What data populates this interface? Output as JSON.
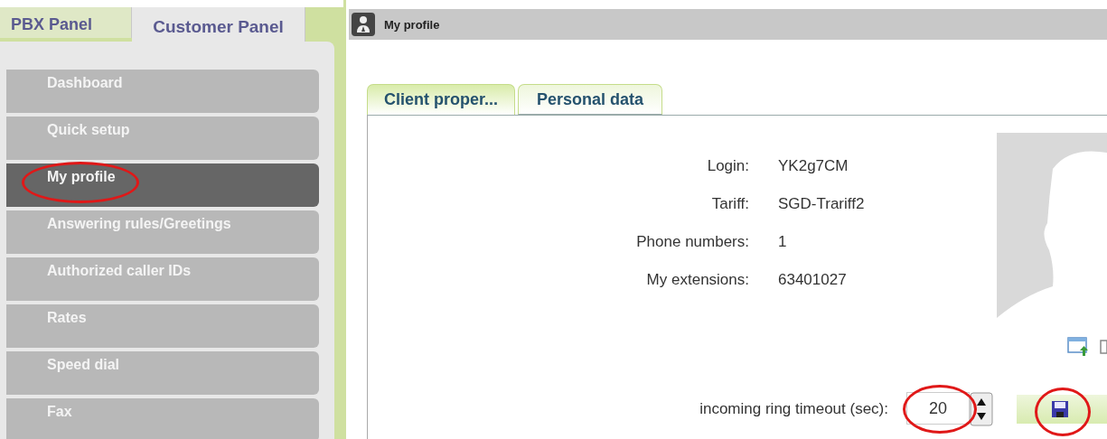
{
  "panel_tabs": [
    {
      "label": "PBX Panel",
      "selected": false
    },
    {
      "label": "Customer Panel",
      "selected": true
    }
  ],
  "sidebar": {
    "items": [
      {
        "label": "Dashboard",
        "selected": false,
        "circled": false
      },
      {
        "label": "Quick setup",
        "selected": false,
        "circled": false
      },
      {
        "label": "My profile",
        "selected": true,
        "circled": true
      },
      {
        "label": "Answering rules/Greetings",
        "selected": false,
        "circled": false
      },
      {
        "label": "Authorized caller IDs",
        "selected": false,
        "circled": false
      },
      {
        "label": "Rates",
        "selected": false,
        "circled": false
      },
      {
        "label": "Speed dial",
        "selected": false,
        "circled": false
      },
      {
        "label": "Fax",
        "selected": false,
        "circled": false
      }
    ]
  },
  "window": {
    "title": "My profile"
  },
  "tabs": [
    {
      "label": "Client proper...",
      "selected": true
    },
    {
      "label": "Personal data",
      "selected": false
    }
  ],
  "fields": [
    {
      "label": "Login:",
      "value": "YK2g7CM"
    },
    {
      "label": "Tariff:",
      "value": "SGD-Trariff2"
    },
    {
      "label": "Phone numbers:",
      "value": "1"
    },
    {
      "label": "My extensions:",
      "value": "63401027"
    }
  ],
  "ring_timeout": {
    "label": "incoming ring timeout (sec):",
    "value": "20",
    "circled": true
  },
  "save_button": {
    "circled": true
  }
}
